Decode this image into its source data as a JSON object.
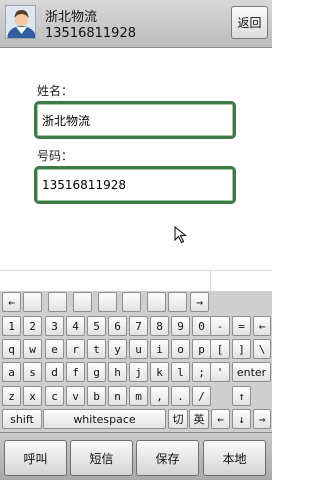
{
  "header": {
    "contact_name": "浙北物流",
    "contact_phone": "13516811928",
    "back_label": "返回"
  },
  "form": {
    "name_label": "姓名：",
    "name_value": "浙北物流",
    "phone_label": "号码：",
    "phone_value": "13516811928"
  },
  "keyboard": {
    "rows": [
      [
        "←",
        "",
        "",
        "",
        "",
        "",
        "",
        "",
        "→"
      ],
      [
        "1",
        "2",
        "3",
        "4",
        "5",
        "6",
        "7",
        "8",
        "9",
        "0",
        "-",
        "=",
        "←"
      ],
      [
        "q",
        "w",
        "e",
        "r",
        "t",
        "y",
        "u",
        "i",
        "o",
        "p",
        "[",
        "]",
        "\\"
      ],
      [
        "a",
        "s",
        "d",
        "f",
        "g",
        "h",
        "j",
        "k",
        "l",
        ";",
        "'",
        "enter"
      ],
      [
        "z",
        "x",
        "c",
        "v",
        "b",
        "n",
        "m",
        ",",
        ".",
        "/",
        "↑"
      ],
      [
        "shift",
        "whitespace",
        "切",
        "英",
        "←",
        "↓",
        "→"
      ]
    ]
  },
  "bottom_bar": {
    "buttons": [
      "呼叫",
      "短信",
      "保存",
      "本地"
    ]
  },
  "colors": {
    "field_border": "#3f7a45",
    "header_bg": "#cccccc",
    "keyboard_bg": "#cfcfcf"
  }
}
